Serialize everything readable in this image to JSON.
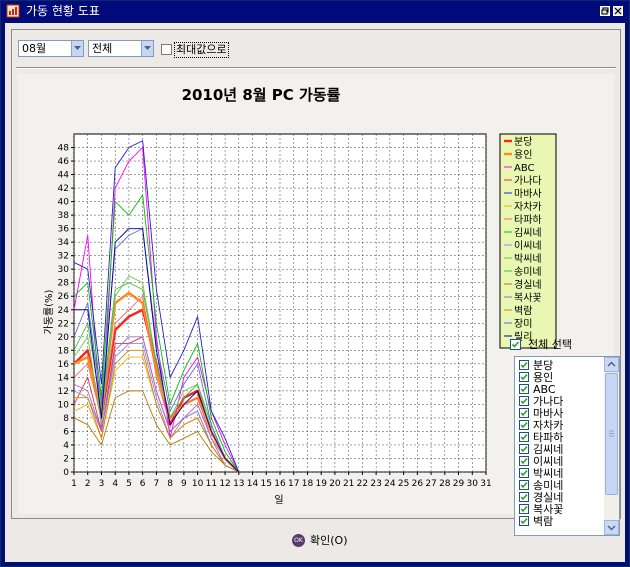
{
  "window": {
    "title": "가동 현황 도표",
    "icon": "report-icon",
    "controls": [
      "restore-icon",
      "close-icon"
    ]
  },
  "toolbar": {
    "month_value": "08월",
    "group_value": "전체",
    "max_label": "최대값으로",
    "max_checked": false
  },
  "chart_data": {
    "type": "line",
    "title": "2010년 8월 PC 가동률",
    "xlabel": "일",
    "ylabel": "가동률(%)",
    "xlim": [
      1,
      31
    ],
    "ylim": [
      0,
      50
    ],
    "x": [
      1,
      2,
      3,
      4,
      5,
      6,
      7,
      8,
      9,
      10,
      11,
      12,
      13
    ],
    "xticks": [
      "1",
      "2",
      "3",
      "4",
      "5",
      "6",
      "7",
      "8",
      "9",
      "10",
      "11",
      "12",
      "13",
      "14",
      "15",
      "16",
      "17",
      "18",
      "19",
      "20",
      "21",
      "22",
      "23",
      "24",
      "25",
      "26",
      "27",
      "28",
      "29",
      "30",
      "31"
    ],
    "yticks": [
      "0",
      "2",
      "4",
      "6",
      "8",
      "10",
      "12",
      "14",
      "16",
      "18",
      "20",
      "22",
      "24",
      "26",
      "28",
      "30",
      "32",
      "34",
      "36",
      "38",
      "40",
      "42",
      "44",
      "46",
      "48"
    ],
    "grid": true,
    "legend": "right",
    "series": [
      {
        "name": "분당",
        "color": "#ff2020",
        "values": [
          16,
          18,
          8,
          21,
          23,
          24,
          16,
          7,
          11,
          12,
          6,
          2,
          0
        ]
      },
      {
        "name": "용인",
        "color": "#ff8c1a",
        "values": [
          16,
          17,
          9,
          25,
          26.5,
          25,
          15,
          8,
          10,
          11,
          6,
          2,
          0
        ]
      },
      {
        "name": "ABC",
        "color": "#ff00ff",
        "values": [
          24,
          35,
          6,
          42,
          46,
          48,
          20,
          5,
          14,
          17,
          9,
          4,
          0
        ]
      },
      {
        "name": "가나다",
        "color": "#e03030",
        "values": [
          10,
          14,
          6,
          19,
          19,
          20,
          12,
          6,
          8,
          9,
          4,
          1,
          0
        ]
      },
      {
        "name": "마바사",
        "color": "#2020cc",
        "values": [
          31,
          30,
          13,
          45,
          48,
          49,
          27,
          14,
          18,
          23,
          9,
          5,
          0
        ]
      },
      {
        "name": "자차카",
        "color": "#ffaa00",
        "values": [
          9,
          10,
          5,
          15,
          17,
          17,
          10,
          5,
          7,
          8,
          4,
          1,
          0
        ]
      },
      {
        "name": "타파하",
        "color": "#ff6666",
        "values": [
          14,
          16,
          8,
          22,
          24,
          26,
          14,
          7,
          10,
          11,
          5,
          2,
          0
        ]
      },
      {
        "name": "김씨네",
        "color": "#00c000",
        "values": [
          26,
          28,
          11,
          40,
          38,
          41,
          22,
          10,
          15,
          19,
          8,
          3,
          0
        ]
      },
      {
        "name": "이씨네",
        "color": "#8888ff",
        "values": [
          12,
          11,
          6,
          17,
          19,
          19,
          11,
          5,
          8,
          9,
          4,
          1,
          0
        ]
      },
      {
        "name": "박씨네",
        "color": "#7cc050",
        "values": [
          17,
          20,
          7,
          26,
          29,
          28,
          16,
          8,
          12,
          13,
          6,
          2,
          0
        ]
      },
      {
        "name": "송미네",
        "color": "#40c040",
        "values": [
          18,
          22,
          9,
          27,
          28,
          27,
          16,
          8,
          11,
          13,
          7,
          2,
          0
        ]
      },
      {
        "name": "경실네",
        "color": "#bb7700",
        "values": [
          8,
          7,
          4,
          11,
          12,
          12,
          7,
          4,
          5,
          6,
          3,
          1,
          0
        ]
      },
      {
        "name": "복사꽃",
        "color": "#aa66cc",
        "values": [
          13,
          12,
          6,
          18,
          20,
          20,
          12,
          6,
          8,
          10,
          5,
          1,
          0
        ]
      },
      {
        "name": "벽람",
        "color": "#cc8800",
        "values": [
          11,
          11,
          5,
          16,
          18,
          18,
          10,
          5,
          7,
          8,
          4,
          1,
          0
        ]
      },
      {
        "name": "장미",
        "color": "#6666dd",
        "values": [
          20,
          25,
          10,
          33,
          35,
          36,
          19,
          9,
          13,
          16,
          7,
          2,
          0
        ]
      },
      {
        "name": "릴리",
        "color": "#000099",
        "values": [
          24,
          24,
          8,
          34,
          36,
          36,
          18,
          7,
          10,
          12,
          6,
          2,
          0
        ]
      }
    ]
  },
  "selection": {
    "select_all_label": "전체 선택",
    "select_all_checked": true,
    "items": [
      "분당",
      "용인",
      "ABC",
      "가나다",
      "마바사",
      "자차카",
      "타파하",
      "김씨네",
      "이씨네",
      "박씨네",
      "송미네",
      "경실네",
      "복사꽃",
      "벽람"
    ]
  },
  "footer": {
    "ok_icon_text": "OK",
    "ok_label": "확인(O)"
  }
}
